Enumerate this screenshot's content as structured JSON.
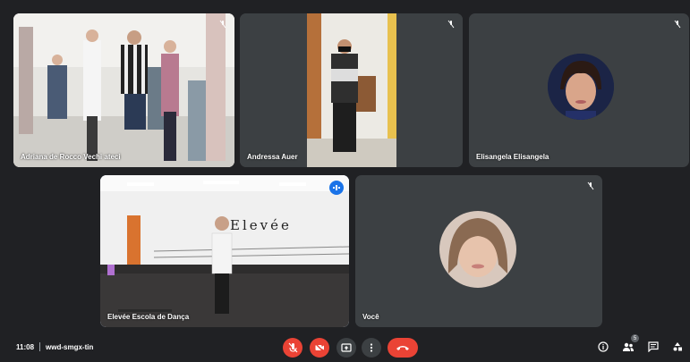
{
  "participants": [
    {
      "name": "Adriana de Rocco Vechi ateci",
      "muted": true
    },
    {
      "name": "Andressa Auer",
      "muted": true
    },
    {
      "name": "Elisangela Elisangela",
      "muted": true
    },
    {
      "name": "Elevée Escola de Dança",
      "speaking": true
    },
    {
      "name": "Você",
      "muted": true
    }
  ],
  "studio_sign": "Elevée",
  "meeting": {
    "time": "11:08",
    "code": "wwd-smgx-tin"
  },
  "controls": {
    "mic": "mic-off-icon",
    "camera": "camera-off-icon",
    "present": "present-icon",
    "more": "more-vert-icon",
    "hangup": "call-end-icon"
  },
  "right_controls": {
    "info": "info-icon",
    "people": "people-icon",
    "people_count": "5",
    "chat": "chat-icon",
    "activities": "activities-icon"
  },
  "colors": {
    "background": "#202124",
    "tile": "#3c4043",
    "danger": "#ea4335",
    "accent": "#1a73e8"
  }
}
